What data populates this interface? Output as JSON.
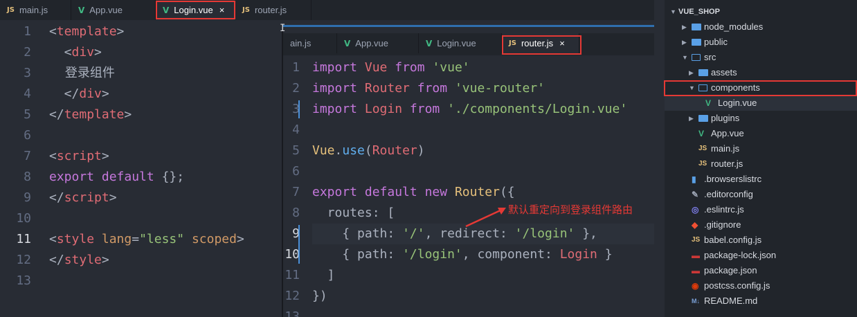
{
  "left_editor": {
    "tabs": [
      {
        "icon": "JS",
        "label": "main.js"
      },
      {
        "icon": "V",
        "label": "App.vue"
      },
      {
        "icon": "V",
        "label": "Login.vue",
        "close": "×"
      },
      {
        "icon": "JS",
        "label": "router.js"
      }
    ],
    "line_numbers": [
      "1",
      "2",
      "3",
      "4",
      "5",
      "6",
      "7",
      "8",
      "9",
      "10",
      "11",
      "12",
      "13"
    ],
    "lines": [
      [
        {
          "t": "<",
          "c": "p"
        },
        {
          "t": "template",
          "c": "tag"
        },
        {
          "t": ">",
          "c": "p"
        }
      ],
      [
        {
          "t": "  <",
          "c": "p"
        },
        {
          "t": "div",
          "c": "tag"
        },
        {
          "t": ">",
          "c": "p"
        }
      ],
      [
        {
          "t": "    登录组件",
          "c": "txt"
        }
      ],
      [
        {
          "t": "  </",
          "c": "p"
        },
        {
          "t": "div",
          "c": "tag"
        },
        {
          "t": ">",
          "c": "p"
        }
      ],
      [
        {
          "t": "</",
          "c": "p"
        },
        {
          "t": "template",
          "c": "tag"
        },
        {
          "t": ">",
          "c": "p"
        }
      ],
      [],
      [
        {
          "t": "<",
          "c": "p"
        },
        {
          "t": "script",
          "c": "tag"
        },
        {
          "t": ">",
          "c": "p"
        }
      ],
      [
        {
          "t": "export",
          "c": "kw"
        },
        {
          "t": " ",
          "c": "p"
        },
        {
          "t": "default",
          "c": "kw"
        },
        {
          "t": " {};",
          "c": "p"
        }
      ],
      [
        {
          "t": "</",
          "c": "p"
        },
        {
          "t": "script",
          "c": "tag"
        },
        {
          "t": ">",
          "c": "p"
        }
      ],
      [],
      [
        {
          "t": "<",
          "c": "p"
        },
        {
          "t": "style",
          "c": "tag"
        },
        {
          "t": " ",
          "c": "p"
        },
        {
          "t": "lang",
          "c": "attr"
        },
        {
          "t": "=",
          "c": "p"
        },
        {
          "t": "\"less\"",
          "c": "str"
        },
        {
          "t": " ",
          "c": "p"
        },
        {
          "t": "scoped",
          "c": "attr"
        },
        {
          "t": ">",
          "c": "p"
        }
      ],
      [
        {
          "t": "</",
          "c": "p"
        },
        {
          "t": "style",
          "c": "tag"
        },
        {
          "t": ">",
          "c": "p"
        }
      ],
      []
    ]
  },
  "right_editor": {
    "tabs": [
      {
        "icon": "",
        "label": "ain.js"
      },
      {
        "icon": "V",
        "label": "App.vue"
      },
      {
        "icon": "V",
        "label": "Login.vue"
      },
      {
        "icon": "JS",
        "label": "router.js",
        "close": "×"
      }
    ],
    "line_numbers": [
      "1",
      "2",
      "3",
      "4",
      "5",
      "6",
      "7",
      "8",
      "9",
      "10",
      "11",
      "12",
      "13"
    ],
    "lines": [
      [
        {
          "t": "import",
          "c": "kw"
        },
        {
          "t": " ",
          "c": "p"
        },
        {
          "t": "Vue",
          "c": "var"
        },
        {
          "t": " ",
          "c": "p"
        },
        {
          "t": "from",
          "c": "kw"
        },
        {
          "t": " ",
          "c": "p"
        },
        {
          "t": "'vue'",
          "c": "str"
        }
      ],
      [
        {
          "t": "import",
          "c": "kw"
        },
        {
          "t": " ",
          "c": "p"
        },
        {
          "t": "Router",
          "c": "var"
        },
        {
          "t": " ",
          "c": "p"
        },
        {
          "t": "from",
          "c": "kw"
        },
        {
          "t": " ",
          "c": "p"
        },
        {
          "t": "'vue-router'",
          "c": "str"
        }
      ],
      [
        {
          "t": "import",
          "c": "kw"
        },
        {
          "t": " ",
          "c": "p"
        },
        {
          "t": "Login",
          "c": "var"
        },
        {
          "t": " ",
          "c": "p"
        },
        {
          "t": "from",
          "c": "kw"
        },
        {
          "t": " ",
          "c": "p"
        },
        {
          "t": "'./components/Login.vue'",
          "c": "str"
        }
      ],
      [],
      [
        {
          "t": "Vue",
          "c": "cls"
        },
        {
          "t": ".",
          "c": "p"
        },
        {
          "t": "use",
          "c": "fn"
        },
        {
          "t": "(",
          "c": "p"
        },
        {
          "t": "Router",
          "c": "var"
        },
        {
          "t": ")",
          "c": "p"
        }
      ],
      [],
      [
        {
          "t": "export",
          "c": "kw"
        },
        {
          "t": " ",
          "c": "p"
        },
        {
          "t": "default",
          "c": "kw"
        },
        {
          "t": " ",
          "c": "p"
        },
        {
          "t": "new",
          "c": "kw"
        },
        {
          "t": " ",
          "c": "p"
        },
        {
          "t": "Router",
          "c": "cls"
        },
        {
          "t": "({",
          "c": "p"
        }
      ],
      [
        {
          "t": "  routes",
          "c": "prop"
        },
        {
          "t": ": [",
          "c": "p"
        }
      ],
      [
        {
          "t": "    { ",
          "c": "p"
        },
        {
          "t": "path",
          "c": "prop"
        },
        {
          "t": ": ",
          "c": "p"
        },
        {
          "t": "'/'",
          "c": "str"
        },
        {
          "t": ", ",
          "c": "p"
        },
        {
          "t": "redirect",
          "c": "prop"
        },
        {
          "t": ": ",
          "c": "p"
        },
        {
          "t": "'/login'",
          "c": "str"
        },
        {
          "t": " },",
          "c": "p"
        }
      ],
      [
        {
          "t": "    { ",
          "c": "p"
        },
        {
          "t": "path",
          "c": "prop"
        },
        {
          "t": ": ",
          "c": "p"
        },
        {
          "t": "'/login'",
          "c": "str"
        },
        {
          "t": ", ",
          "c": "p"
        },
        {
          "t": "component",
          "c": "prop"
        },
        {
          "t": ": ",
          "c": "p"
        },
        {
          "t": "Login",
          "c": "var"
        },
        {
          "t": " }",
          "c": "p"
        }
      ],
      [
        {
          "t": "  ]",
          "c": "p"
        }
      ],
      [
        {
          "t": "})",
          "c": "p"
        }
      ],
      []
    ],
    "annotation": "默认重定向到登录组件路由"
  },
  "sidebar": {
    "project_title": "VUE_SHOP",
    "items": [
      {
        "label": "node_modules",
        "type": "folder",
        "icon": "folder-icon"
      },
      {
        "label": "public",
        "type": "folder",
        "icon": "folder-icon"
      },
      {
        "label": "src",
        "type": "folder-open",
        "icon": "folder-open-icon"
      },
      {
        "label": "assets",
        "type": "folder",
        "icon": "folder-icon"
      },
      {
        "label": "components",
        "type": "folder-open",
        "icon": "folder-open-icon"
      },
      {
        "label": "Login.vue",
        "type": "vue",
        "glyph": "V"
      },
      {
        "label": "plugins",
        "type": "folder",
        "icon": "folder-icon"
      },
      {
        "label": "App.vue",
        "type": "vue",
        "glyph": "V"
      },
      {
        "label": "main.js",
        "type": "js",
        "glyph": "JS"
      },
      {
        "label": "router.js",
        "type": "js",
        "glyph": "JS"
      },
      {
        "label": ".browserslistrc",
        "type": "file",
        "icon": "browserslist-icon"
      },
      {
        "label": ".editorconfig",
        "type": "file",
        "icon": "editorconfig-icon"
      },
      {
        "label": ".eslintrc.js",
        "type": "file",
        "icon": "eslint-icon"
      },
      {
        "label": ".gitignore",
        "type": "file",
        "icon": "git-icon"
      },
      {
        "label": "babel.config.js",
        "type": "js",
        "glyph": "JS"
      },
      {
        "label": "package-lock.json",
        "type": "file",
        "icon": "npm-icon"
      },
      {
        "label": "package.json",
        "type": "file",
        "icon": "npm-icon"
      },
      {
        "label": "postcss.config.js",
        "type": "file",
        "icon": "postcss-icon"
      },
      {
        "label": "README.md",
        "type": "file",
        "icon": "markdown-icon",
        "glyph": "M↓"
      }
    ]
  }
}
